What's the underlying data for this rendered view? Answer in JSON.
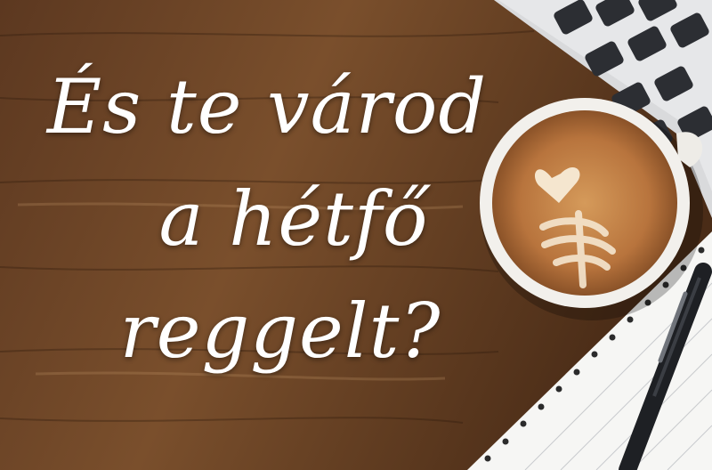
{
  "headline": {
    "line1": "És te várod",
    "line2": "a hétfő",
    "line3": "reggelt?"
  },
  "icons": [
    "laptop-keyboard",
    "coffee-cup",
    "notebook",
    "pen"
  ],
  "colors": {
    "wood": "#6b4326",
    "text": "#ffffff",
    "foam": "#c8874a",
    "cup": "#f2f0ec",
    "notebook": "#f6f6f4",
    "pen": "#1e2024"
  }
}
